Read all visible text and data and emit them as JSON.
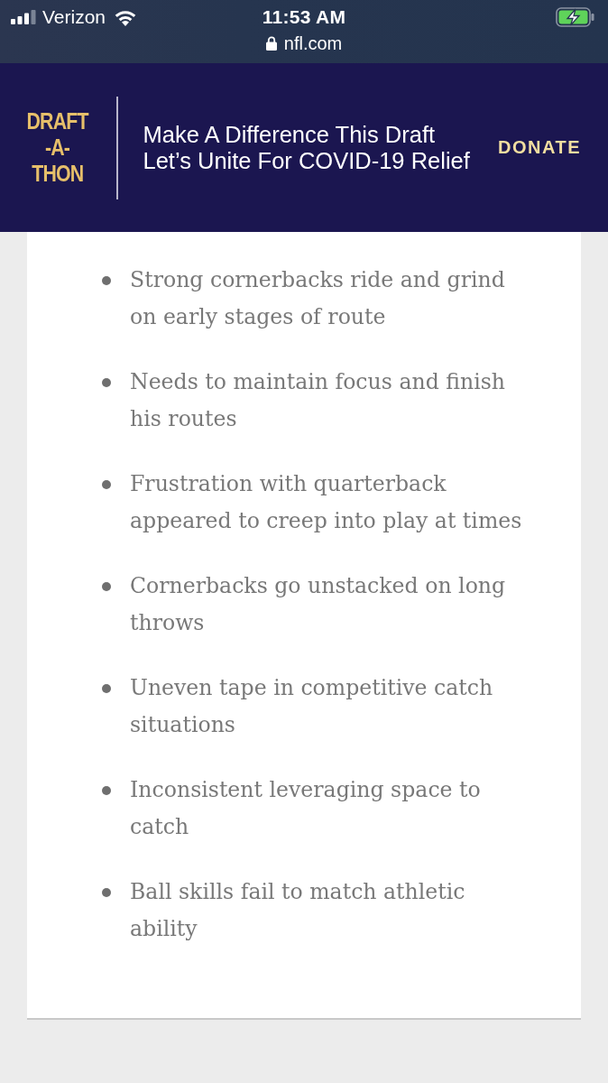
{
  "status_bar": {
    "carrier": "Verizon",
    "time": "11:53 AM",
    "url": "nfl.com",
    "charging": true
  },
  "banner": {
    "logo_lines": [
      "DRAFT",
      "-A-",
      "THON"
    ],
    "headline_lines": [
      "Make A Difference This Draft",
      "Let’s Unite For COVID-19 Relief"
    ],
    "button": "DONATE"
  },
  "list": {
    "items": [
      "Strong cornerbacks ride and grind on early stages of route",
      "Needs to maintain focus and finish his routes",
      "Frustration with quarterback appeared to creep into play at times",
      "Cornerbacks go unstacked on long throws",
      "Uneven tape in competitive catch situations",
      "Inconsistent leveraging space to catch",
      "Ball skills fail to match athletic ability"
    ]
  }
}
